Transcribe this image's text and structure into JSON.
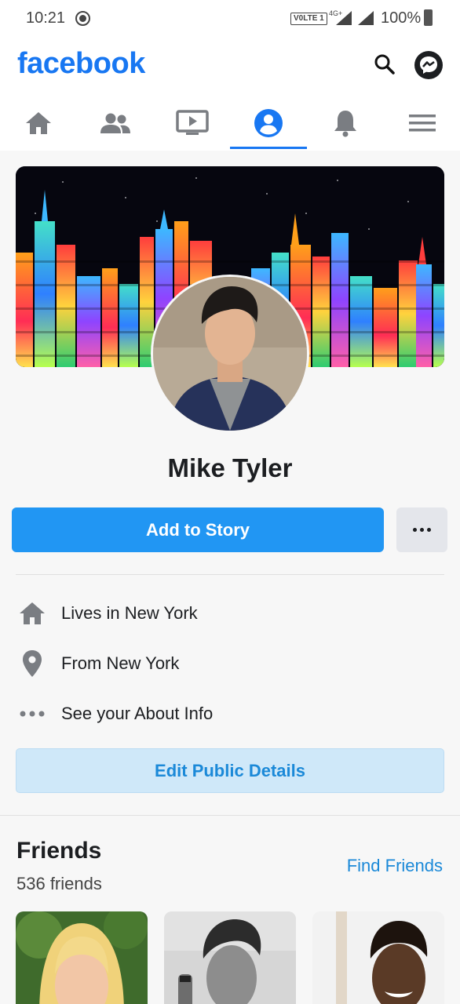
{
  "status_bar": {
    "time": "10:21",
    "volte": "V0LTE 1",
    "network": "4G+",
    "battery": "100%"
  },
  "header": {
    "logo": "facebook",
    "brand_color": "#1877f2"
  },
  "tabs": [
    {
      "icon": "home-icon",
      "active": false
    },
    {
      "icon": "friends-icon",
      "active": false
    },
    {
      "icon": "watch-icon",
      "active": false
    },
    {
      "icon": "profile-icon",
      "active": true
    },
    {
      "icon": "bell-icon",
      "active": false
    },
    {
      "icon": "menu-icon",
      "active": false
    }
  ],
  "profile": {
    "name": "Mike Tyler"
  },
  "actions": {
    "add_story": "Add to Story"
  },
  "intro": {
    "lives_in": "Lives in New York",
    "from": "From New York",
    "about": "See your About Info",
    "edit_button": "Edit Public Details"
  },
  "friends": {
    "title": "Friends",
    "count": "536 friends",
    "find_link": "Find Friends"
  }
}
